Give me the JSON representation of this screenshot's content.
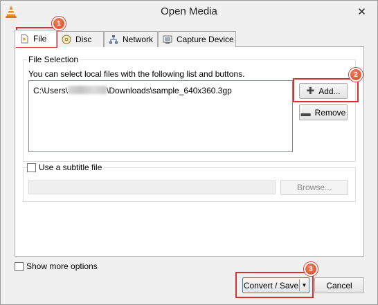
{
  "window": {
    "title": "Open Media",
    "close_glyph": "✕"
  },
  "tabs": [
    {
      "label": "File",
      "icon": "file-icon",
      "active": true
    },
    {
      "label": "Disc",
      "icon": "disc-icon",
      "active": false
    },
    {
      "label": "Network",
      "icon": "network-icon",
      "active": false
    },
    {
      "label": "Capture Device",
      "icon": "capture-device-icon",
      "active": false
    }
  ],
  "file_selection": {
    "group_title": "File Selection",
    "hint": "You can select local files with the following list and buttons.",
    "file_prefix": "C:\\Users\\",
    "file_suffix": "\\Downloads\\sample_640x360.3gp",
    "add_label": "Add...",
    "add_icon_glyph": "✚",
    "remove_label": "Remove",
    "remove_icon_glyph": "▬"
  },
  "subtitle": {
    "checkbox_label": "Use a subtitle file",
    "checked": false,
    "input_value": "",
    "browse_label": "Browse..."
  },
  "footer": {
    "more_options_label": "Show more options",
    "convert_label": "Convert / Save",
    "dropdown_glyph": "▼",
    "cancel_label": "Cancel"
  },
  "annotations": [
    {
      "number": "1",
      "target": "File tab"
    },
    {
      "number": "2",
      "target": "Add button"
    },
    {
      "number": "3",
      "target": "Convert / Save button"
    }
  ],
  "colors": {
    "annotation_red": "#d9302c",
    "accent_blue": "#3c7fb1"
  }
}
